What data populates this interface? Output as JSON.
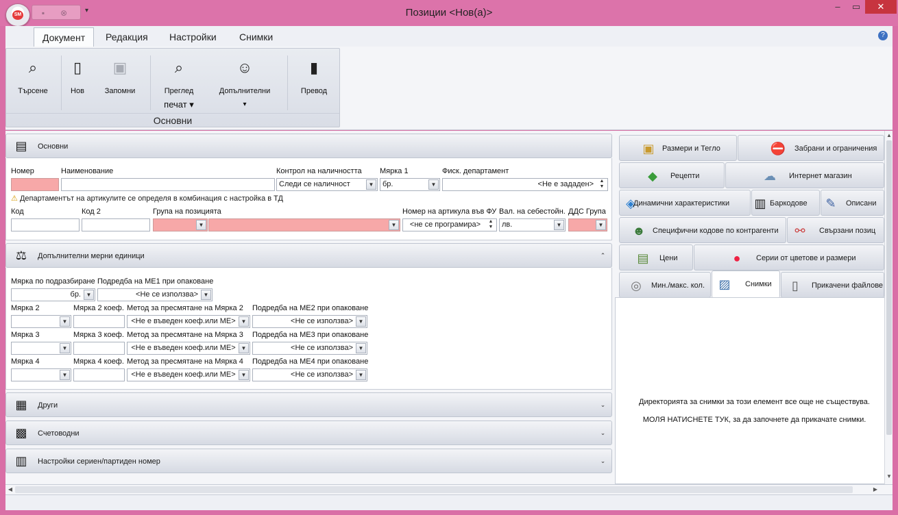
{
  "window": {
    "title": "Позиции <Нов(а)>",
    "logo": "SM",
    "minimize": "–",
    "restore": "▭",
    "close": "✕"
  },
  "ribbon": {
    "tabs": [
      "Документ",
      "Редакция",
      "Настройки",
      "Снимки"
    ],
    "group_label": "Основни",
    "buttons": {
      "search": "Търсене",
      "new": "Нов",
      "save": "Запомни",
      "preview_line1": "Преглед",
      "preview_line2": "печат ▾",
      "additional": "Допълнителни",
      "additional_arrow": "▾",
      "translate": "Превод"
    }
  },
  "sections": {
    "basic": "Основни",
    "extra_units": "Допълнителни мерни единици",
    "other": "Други",
    "accounting": "Счетоводни",
    "serial": "Настройки сериен/партиден номер"
  },
  "basic": {
    "labels": {
      "number": "Номер",
      "name": "Наименование",
      "stock_control": "Контрол на наличността",
      "unit1": "Мярка 1",
      "fiscal_dept": "Фиск. департамент",
      "code": "Код",
      "code2": "Код 2",
      "group": "Група на позицията",
      "fu_number": "Номер на артикула във ФУ",
      "cost_currency": "Вал. на себестойн.",
      "vat_group": "ДДС Група"
    },
    "values": {
      "number": "",
      "name": "",
      "stock_control": "Следи се наличност",
      "unit1": "бр.",
      "fiscal_dept": "<Не е зададен>",
      "code": "",
      "code2": "",
      "group": "",
      "fu_number": "<не се програмира>",
      "cost_currency": "лв.",
      "vat_group": ""
    },
    "warning": "Департаментът на артикулите се определя в комбинация с настройка в ТД"
  },
  "units": {
    "default_label": "Мярка по подразбиране",
    "default_value": "бр.",
    "me1_label": "Подредба на МЕ1 при опаковане",
    "me1_value": "<Не се използва>",
    "rows": [
      {
        "unit_label": "Мярка 2",
        "coef_label": "Мярка 2 коеф.",
        "method_label": "Метод за пресмятане на Мярка 2",
        "order_label": "Подредба на МЕ2 при опаковане",
        "method_value": "<Не е въведен коеф.или МЕ>",
        "order_value": "<Не се използва>"
      },
      {
        "unit_label": "Мярка 3",
        "coef_label": "Мярка 3 коеф.",
        "method_label": "Метод за пресмятане на Мярка 3",
        "order_label": "Подредба на МЕ3 при опаковане",
        "method_value": "<Не е въведен коеф.или МЕ>",
        "order_value": "<Не се използва>"
      },
      {
        "unit_label": "Мярка 4",
        "coef_label": "Мярка 4 коеф.",
        "method_label": "Метод за пресмятане на Мярка 4",
        "order_label": "Подредба на МЕ4 при опаковане",
        "method_value": "<Не е въведен коеф.или МЕ>",
        "order_value": "<Не се използва>"
      }
    ]
  },
  "right_tabs": {
    "dimensions": "Размери и Тегло",
    "restrictions": "Забрани и ограничения",
    "recipes": "Рецепти",
    "web_shop": "Интернет магазин",
    "dynamic": "Динамични характеристики",
    "barcodes": "Баркодове",
    "description": "Описани",
    "partner_codes": "Специфични кодове по контрагенти",
    "related": "Свързани позиц",
    "prices": "Цени",
    "series": "Серии от цветове и размери",
    "minmax": "Мин./макс. кол.",
    "images": "Снимки",
    "attachments": "Прикачени файлове"
  },
  "gallery": {
    "line1": "Директорията за снимки за този елемент все още не съществува.",
    "line2": "МОЛЯ НАТИСНЕТЕ ТУК, за да започнете да прикачате снимки."
  },
  "colors": {
    "title_bar": "#dc73aa",
    "required_field": "#f7a8a8",
    "close_button": "#c7343f"
  }
}
